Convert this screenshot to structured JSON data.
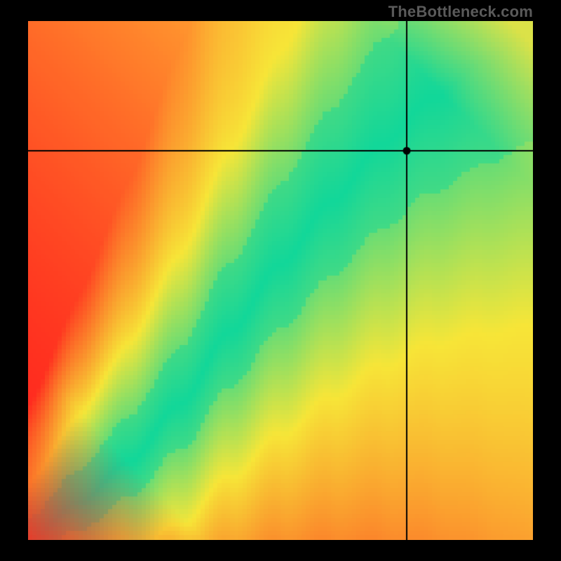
{
  "watermark": "TheBottleneck.com",
  "chart_data": {
    "type": "heatmap",
    "title": "",
    "xlabel": "",
    "ylabel": "",
    "xlim": [
      0,
      100
    ],
    "ylim": [
      0,
      100
    ],
    "grid": false,
    "legend_position": "none",
    "description": "Pixelated heatmap. Color encodes deviation from an ideal curve: green along the curve, fading through yellow/orange to red far from it. A black crosshair marks a single point with a dot at its intersection.",
    "colors": {
      "on_curve": "#12d79a",
      "mid": "#f7e638",
      "far": "#ff2c1f",
      "far_upper_right": "#ffe43a"
    },
    "ideal_curve_samples_xy": [
      [
        0,
        0
      ],
      [
        10,
        7
      ],
      [
        20,
        15
      ],
      [
        30,
        26
      ],
      [
        40,
        40
      ],
      [
        50,
        53
      ],
      [
        60,
        65
      ],
      [
        70,
        76
      ],
      [
        80,
        85
      ],
      [
        90,
        92
      ],
      [
        100,
        98
      ]
    ],
    "marker": {
      "x": 75,
      "y": 75
    },
    "pixelation_cells": 120
  }
}
